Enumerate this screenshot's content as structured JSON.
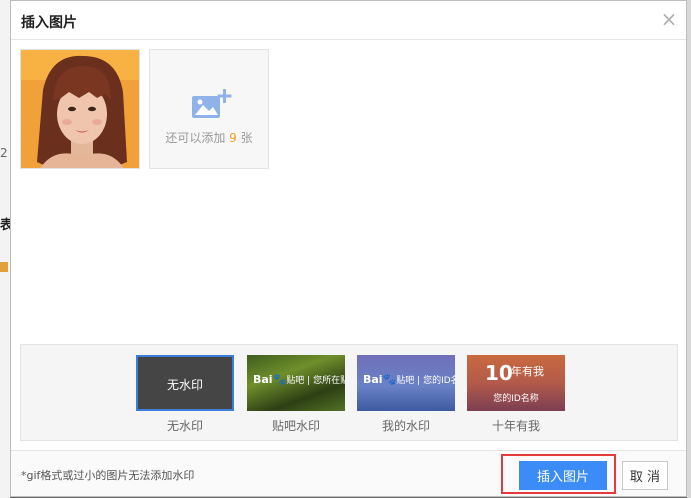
{
  "background": {
    "edge_text_1": "2",
    "edge_text_2": "表"
  },
  "dialog": {
    "title": "插入图片",
    "close_icon": "close-icon"
  },
  "images": {
    "photo_icon": "photo-thumbnail",
    "add_tile": {
      "prefix": "还可以添加",
      "count": "9",
      "suffix": "张",
      "icon": "add-image-icon",
      "icon_color": "#8fb3e8"
    }
  },
  "watermarks": {
    "selected_color": "#3b7dd8",
    "items": [
      {
        "thumb_text": "无水印",
        "label": "无水印"
      },
      {
        "thumb_text": "您所在贴吧",
        "brand": "Bai",
        "brand_suffix": "贴吧",
        "label": "贴吧水印"
      },
      {
        "thumb_text": "您的ID名称",
        "brand": "Bai",
        "brand_suffix": "贴吧",
        "label": "我的水印"
      },
      {
        "thumb_big": "10",
        "thumb_small": "年有我",
        "thumb_text": "您的ID名称",
        "label": "十年有我"
      }
    ]
  },
  "footer": {
    "note": "*gif格式或过小的图片无法添加水印",
    "insert_label": "插入图片",
    "cancel_label": "取 消",
    "primary_color": "#3b8cf7",
    "highlight_color": "#e33b3b"
  }
}
